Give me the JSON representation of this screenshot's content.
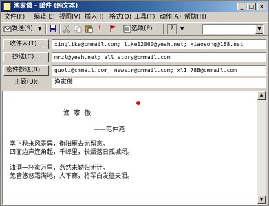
{
  "window": {
    "title": "渔家傲 - 邮件 (纯文本)",
    "buttons": [
      "_",
      "□",
      "×"
    ]
  },
  "menu": [
    "文件(F)",
    "编辑(E)",
    "视图(V)",
    "插入(I)",
    "格式(O)",
    "工具(T)",
    "动作(A)",
    "帮助(H)"
  ],
  "toolbar": {
    "send_label": "发送(S)",
    "options_label": "选项(P)...",
    "help_label": "?",
    "combo_value": ""
  },
  "header": {
    "to_label": "收件人(T)...",
    "cc_label": "抄送(C)...",
    "bcc_label": "密件抄送(B)...",
    "subject_label": "主题(U):",
    "to": [
      "xinglike@cmmail.com",
      "like12060@yeah.net",
      "xiaosong@188.net"
    ],
    "cc": [
      "mrzl@yeah.net",
      "all_story@cmmail.com"
    ],
    "bcc": [
      "guoli@cmmail.com",
      "newsir@cmmail.com",
      "xl1_788@cmmail.com"
    ],
    "subject": "渔家傲"
  },
  "poem": {
    "title": "渔 家 傲",
    "author": "——范仲淹",
    "lines": [
      "塞下秋来风景异，衡阳雁去无留意。",
      "四面边声连角起，千嶂里，长烟落日孤城闭。",
      "浊酒一杯家万里，燕然未勒归无计。",
      "羌管悠悠霜满地，人不寐，将军白发征夫泪。"
    ]
  }
}
